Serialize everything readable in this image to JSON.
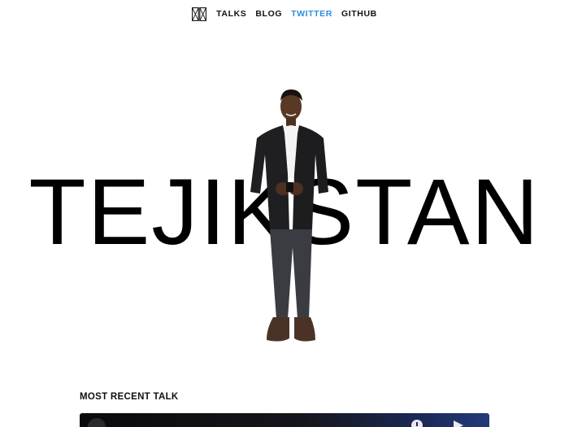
{
  "nav": {
    "logo_icon": "split-square-logo-icon",
    "links": [
      {
        "label": "TALKS",
        "active": false
      },
      {
        "label": "BLOG",
        "active": false
      },
      {
        "label": "TWITTER",
        "active": true
      },
      {
        "label": "GITHUB",
        "active": false
      }
    ]
  },
  "hero": {
    "name": "TEJIKSTAN",
    "person_image": "presenter-standing-photo"
  },
  "recent_talk": {
    "heading": "MOST RECENT TALK",
    "video_icons": [
      "play-icon",
      "clock-icon",
      "share-icon"
    ]
  },
  "colors": {
    "accent_link": "#2b8de0",
    "text": "#111111",
    "background": "#ffffff"
  }
}
